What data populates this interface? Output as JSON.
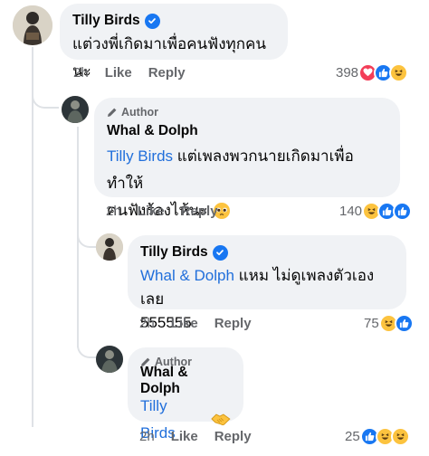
{
  "comments": [
    {
      "author": "Tilly Birds",
      "verified": true,
      "is_author": false,
      "text": "แต่วงพี่เกิดมาเพื่อคนฟังทุกคนนะ",
      "time": "2h",
      "like_label": "Like",
      "reply_label": "Reply",
      "reaction_count": "398",
      "reactions": [
        "love",
        "like",
        "haha"
      ]
    },
    {
      "author_tag": "Author",
      "author": "Whal & Dolph",
      "verified": false,
      "mention": "Tilly Birds",
      "text_line1": "แต่เพลงพวกนายเกิดมาเพื่อทำให้",
      "text_line2": "คนฟังร้องไห้นะ",
      "emoji": "pleading-face",
      "time": "2h",
      "like_label": "Like",
      "reply_label": "Reply",
      "reaction_count": "140",
      "reactions": [
        "haha",
        "like",
        "like"
      ]
    },
    {
      "author": "Tilly Birds",
      "verified": true,
      "mention": "Whal & Dolph",
      "text_line1": "แหม ไม่ดูเพลงตัวเองเลย",
      "text_line2": "555555",
      "time": "2h",
      "like_label": "Like",
      "reply_label": "Reply",
      "reaction_count": "75",
      "reactions": [
        "haha",
        "like"
      ]
    },
    {
      "author_tag": "Author",
      "author": "Whal & Dolph",
      "verified": false,
      "mention": "Tilly Birds",
      "emoji": "handshake",
      "time": "2h",
      "like_label": "Like",
      "reply_label": "Reply",
      "reaction_count": "25",
      "reactions": [
        "like",
        "haha",
        "haha"
      ]
    }
  ],
  "colors": {
    "bubble": "#f0f2f5",
    "mention": "#216fdb",
    "meta": "#65676b",
    "like": "#1877f2",
    "love": "#f33e58",
    "haha": "#fcc33f"
  }
}
